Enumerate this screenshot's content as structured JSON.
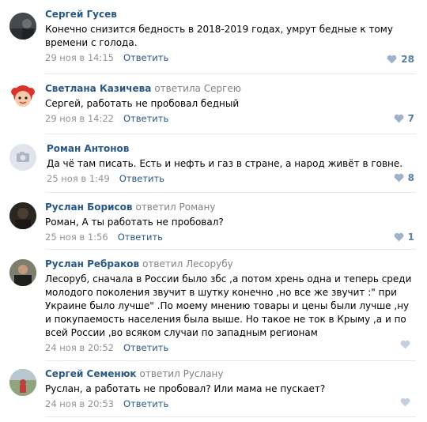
{
  "comments": [
    {
      "author": "Сергей Гусев",
      "reply_to": "",
      "text": "Конечно снизится бедность в 2018-2019 годах, умрут бедные к тому времени с голода.",
      "date": "29 ноя в 14:15",
      "reply_label": "Ответить",
      "likes": "28",
      "avatar": "photo-dark"
    },
    {
      "author": "Светлана Казичева",
      "reply_to": "ответила Сергею",
      "text": "Сергей, работать не пробовал бедный",
      "date": "29 ноя в 14:22",
      "reply_label": "Ответить",
      "likes": "7",
      "avatar": "cartoon-red-hair"
    },
    {
      "author": "Роман Антонов",
      "reply_to": "",
      "text": "Да чё там писать. Есть и нефть и газ в стране, а народ живёт в говне.",
      "date": "25 ноя в 1:49",
      "reply_label": "Ответить",
      "likes": "8",
      "avatar": "camera-placeholder"
    },
    {
      "author": "Руслан Борисов",
      "reply_to": "ответил Роману",
      "text": "Роман, А ты работать не пробовал?",
      "date": "25 ноя в 1:56",
      "reply_label": "Ответить",
      "likes": "1",
      "avatar": "photo-dark-man"
    },
    {
      "author": "Руслан Ребраков",
      "reply_to": "ответил Лесорубу",
      "text": "Лесоруб, сначала в России было збс ,а потом хрень одна и теперь среди молодого поколения звучит в шутку конечно ,но все же звучит :\" при Украине было лучше\" .По моему мнению товары и цены были лучше ,ну и покупаемость населения была выше. Но такое не ток в Крыму ,а и по всей России ,во всяком случаи по западным регионам",
      "date": "24 ноя в 20:52",
      "reply_label": "Ответить",
      "likes": "",
      "avatar": "photo-man-dark-jacket"
    },
    {
      "author": "Сергей Семенюк",
      "reply_to": "ответил Руслану",
      "text": "Руслан, а работать не пробовал? Или мама не пускает?",
      "date": "24 ноя в 20:53",
      "reply_label": "Ответить",
      "likes": "",
      "avatar": "photo-outdoor"
    }
  ],
  "colors": {
    "link": "#2a5885",
    "meta": "#939393",
    "like": "#5b7fa6",
    "separator": "#e7e8ec"
  }
}
